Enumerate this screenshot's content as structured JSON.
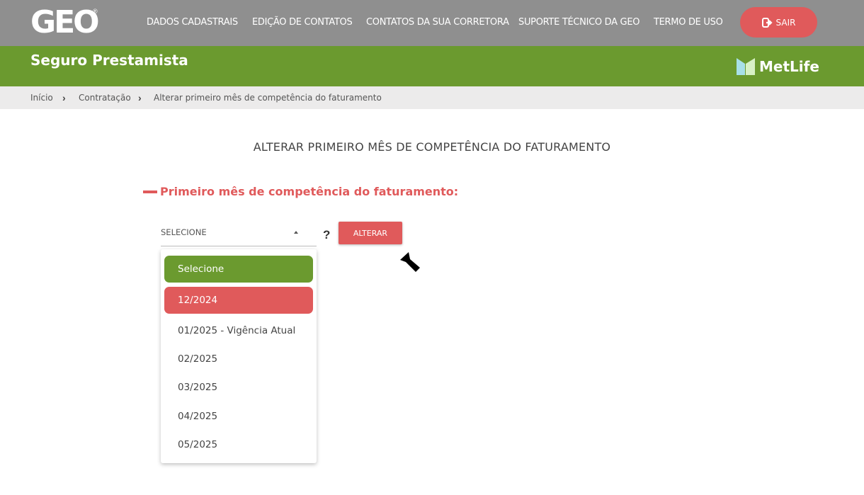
{
  "header": {
    "logo": "GEO",
    "logo_reg": "®",
    "nav": [
      {
        "label": "DADOS CADASTRAIS"
      },
      {
        "label": "EDIÇÃO DE CONTATOS"
      },
      {
        "label": "CONTATOS DA SUA CORRETORA"
      },
      {
        "label": "SUPORTE TÉCNICO DA GEO"
      },
      {
        "label": "TERMO DE USO"
      }
    ],
    "logout_label": "SAIR"
  },
  "band": {
    "title": "Seguro Prestamista",
    "partner_logo": "MetLife"
  },
  "breadcrumb": [
    "Início",
    "Contratação",
    "Alterar primeiro mês de competência do faturamento"
  ],
  "main": {
    "title": "ALTERAR PRIMEIRO MÊS DE COMPETÊNCIA DO FATURAMENTO",
    "section_title": "Primeiro mês de competência do faturamento:",
    "select_value": "SELECIONE",
    "help": "?",
    "alter_button": "ALTERAR",
    "options": [
      "Selecione",
      "12/2024",
      "01/2025 - Vigência Atual",
      "02/2025",
      "03/2025",
      "04/2025",
      "05/2025"
    ]
  },
  "colors": {
    "topbar": "#8f8f8f",
    "band": "#6b9a2f",
    "accent_red": "#e05a5b",
    "breadcrumb_bg": "#ecebeb"
  },
  "icons": {
    "logout": "sign-out-icon",
    "breadcrumb_sep": "chevron-right-icon",
    "caret": "caret-up-icon",
    "cursor": "mouse-pointer-icon"
  }
}
